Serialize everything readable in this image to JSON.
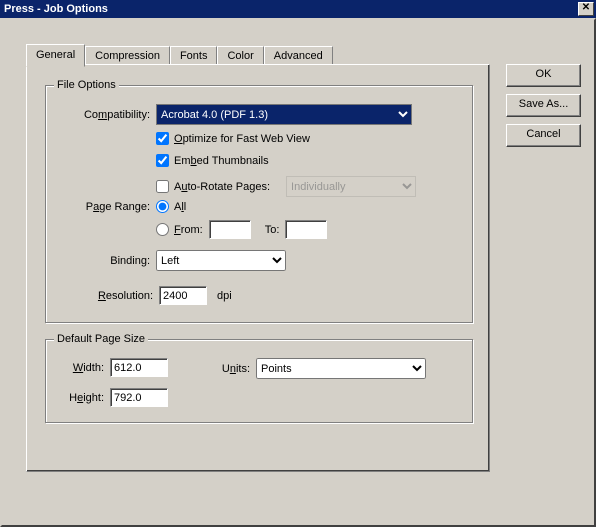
{
  "window": {
    "title": "Press - Job Options"
  },
  "tabs": {
    "general": "General",
    "compression": "Compression",
    "fonts": "Fonts",
    "color": "Color",
    "advanced": "Advanced"
  },
  "buttons": {
    "ok": "OK",
    "save_as": "Save As...",
    "cancel": "Cancel"
  },
  "file_options": {
    "legend": "File Options",
    "compat_label_pre": "Co",
    "compat_label_u": "m",
    "compat_label_post": "patibility:",
    "compat_value": "Acrobat 4.0 (PDF 1.3)",
    "optimize_pre": "",
    "optimize_u": "O",
    "optimize_post": "ptimize for Fast Web View",
    "optimize_checked": true,
    "embed_pre": "Em",
    "embed_u": "b",
    "embed_post": "ed Thumbnails",
    "embed_checked": true,
    "auto_pre": "A",
    "auto_u": "u",
    "auto_post": "to-Rotate Pages:",
    "auto_checked": false,
    "auto_value": "Individually",
    "page_range_pre": "P",
    "page_range_u": "a",
    "page_range_post": "ge Range:",
    "all_pre": "A",
    "all_u": "l",
    "all_post": "l",
    "from_u": "F",
    "from_post": "rom:",
    "to_label": "To:",
    "from_value": "",
    "to_value": "",
    "binding_pre": "Bindin",
    "binding_u": "g",
    "binding_post": ":",
    "binding_value": "Left",
    "res_u": "R",
    "res_post": "esolution:",
    "res_value": "2400",
    "res_unit": "dpi"
  },
  "page_size": {
    "legend": "Default Page Size",
    "width_u": "W",
    "width_post": "idth:",
    "width_value": "612.0",
    "height_pre": "H",
    "height_u": "e",
    "height_post": "ight:",
    "height_value": "792.0",
    "units_pre": "U",
    "units_u": "n",
    "units_post": "its:",
    "units_value": "Points"
  }
}
